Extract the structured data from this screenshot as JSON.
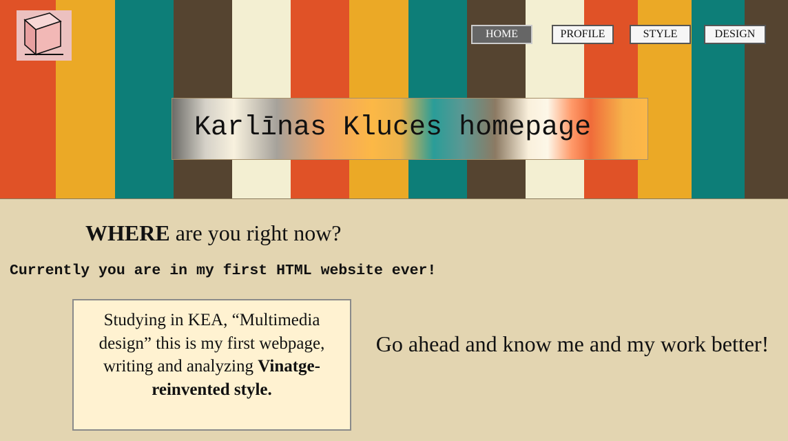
{
  "header": {
    "title": "Karlīnas Kluces homepage",
    "stripe_colors": [
      "#e05227",
      "#eba926",
      "#0d7e78",
      "#554430",
      "#f3efd2",
      "#e05227",
      "#eba926",
      "#0d7e78",
      "#554430",
      "#f3efd2",
      "#e05227",
      "#eba926",
      "#0d7e78",
      "#554430"
    ],
    "logo_icon": "cube-icon"
  },
  "nav": {
    "items": [
      {
        "label": "HOME",
        "active": true
      },
      {
        "label": "PROFILE",
        "active": false
      },
      {
        "label": "STYLE",
        "active": false
      },
      {
        "label": "DESIGN",
        "active": false
      }
    ]
  },
  "main": {
    "where_bold": "WHERE",
    "where_rest": " are you right now?",
    "current_text": "Currently you are in my first HTML website ever!",
    "study_text": "Studying in KEA, “Multimedia design” this is my first webpage, writing and analyzing ",
    "study_bold": "Vinatge- reinvented style.",
    "cta": "Go ahead and know me and my work better!"
  },
  "colors": {
    "background": "#e3d5b1",
    "study_box": "#fff2d1",
    "nav_active": "#666666"
  }
}
